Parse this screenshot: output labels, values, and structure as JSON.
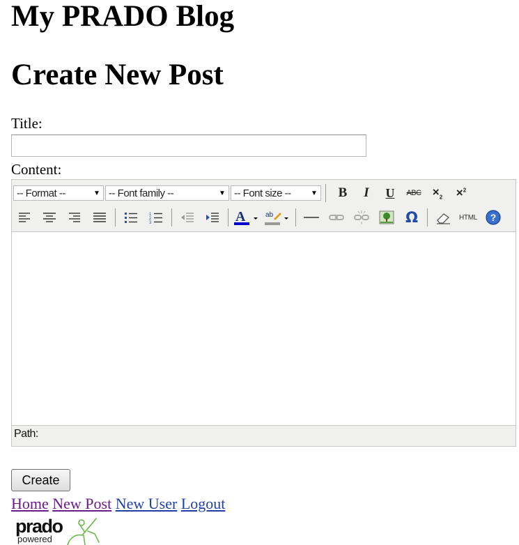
{
  "site": {
    "title": "My PRADO Blog"
  },
  "page": {
    "heading": "Create New Post"
  },
  "form": {
    "title_label": "Title:",
    "title_value": "",
    "content_label": "Content:",
    "create_button": "Create"
  },
  "editor": {
    "format_select": "-- Format --",
    "font_family_select": "-- Font family --",
    "font_size_select": "-- Font size --",
    "bold": "B",
    "italic": "I",
    "underline": "U",
    "strikethrough": "ABC",
    "html_button": "HTML",
    "path_label": "Path:",
    "font_color": "#0000cc",
    "highlight_color": "#999999"
  },
  "nav": {
    "home": "Home",
    "new_post": "New Post",
    "new_user": "New User",
    "logout": "Logout"
  },
  "logo": {
    "wordmark": "prado",
    "tagline": "powered"
  }
}
